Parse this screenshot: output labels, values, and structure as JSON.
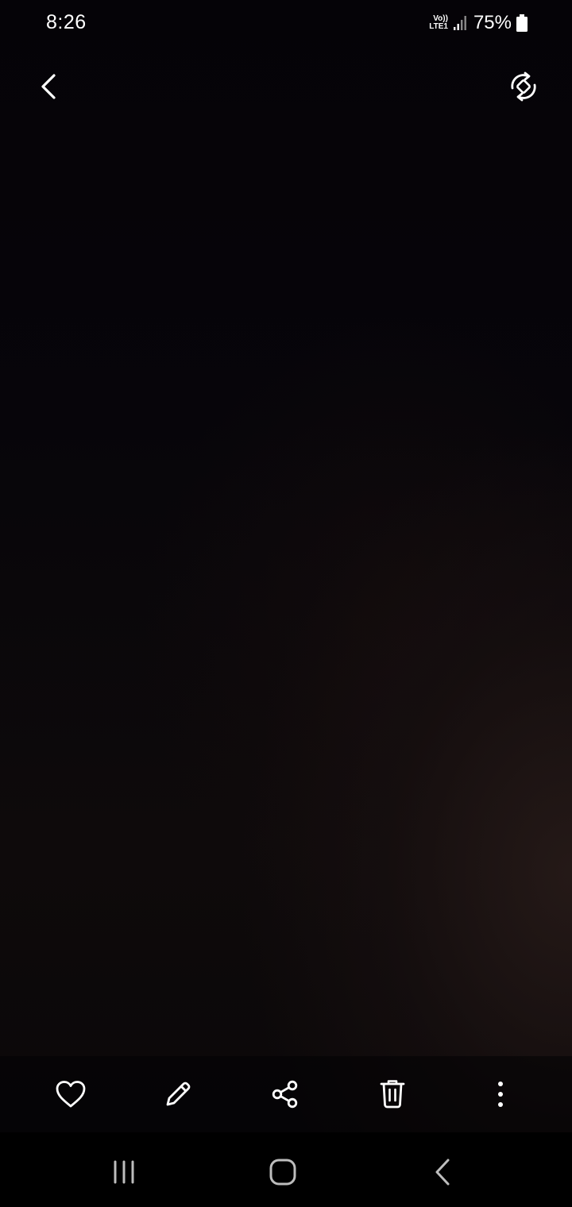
{
  "status_bar": {
    "time": "8:26",
    "network_top": "Vo))",
    "network_bottom": "LTE1",
    "battery": "75%"
  },
  "toolbar": {
    "back_icon": "chevron-left-icon",
    "rotate_icon": "auto-rotate-icon"
  },
  "action_bar": {
    "items": [
      {
        "icon": "heart-icon"
      },
      {
        "icon": "pencil-icon"
      },
      {
        "icon": "share-icon"
      },
      {
        "icon": "trash-icon"
      },
      {
        "icon": "more-vertical-icon"
      }
    ]
  },
  "nav_bar": {
    "items": [
      {
        "icon": "recents-icon"
      },
      {
        "icon": "home-icon"
      },
      {
        "icon": "back-icon"
      }
    ]
  },
  "colors": {
    "icon": "#ffffff",
    "nav_icon": "#bdbdbd",
    "background": "#060407"
  }
}
